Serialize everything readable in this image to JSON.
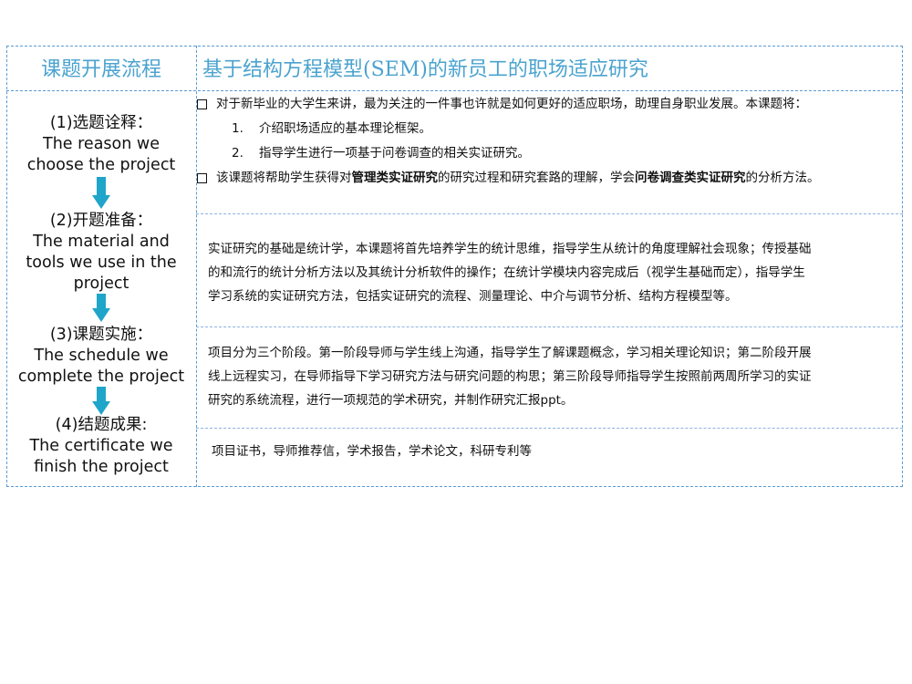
{
  "left": {
    "title": "课题开展流程",
    "steps": [
      {
        "cn": "(1)选题诠释：",
        "en1": "The reason we",
        "en2": "choose the project"
      },
      {
        "cn": "(2)开题准备：",
        "en1": "The material and",
        "en2": "tools we use in the",
        "en3": "project"
      },
      {
        "cn": "(3)课题实施：",
        "en1": "The schedule we",
        "en2": "complete the project"
      },
      {
        "cn": "(4)结题成果:",
        "en1": "The certificate we",
        "en2": "finish the project"
      }
    ]
  },
  "main": {
    "title": "基于结构方程模型(SEM)的新员工的职场适应研究",
    "section1": {
      "bullet1": "对于新毕业的大学生来讲，最为关注的一件事也许就是如何更好的适应职场，助理自身职业发展。本课题将：",
      "items": [
        {
          "num": "1.",
          "text": "介绍职场适应的基本理论框架。"
        },
        {
          "num": "2.",
          "text": "指导学生进行一项基于问卷调查的相关实证研究。"
        }
      ],
      "bullet2_a": "该课题将帮助学生获得对",
      "bullet2_b": "管理类实证研究",
      "bullet2_c": "的研究过程和研究套路的理解，学会",
      "bullet2_d": "问卷调查类实证研究",
      "bullet2_e": "的分析方法。"
    },
    "section2": {
      "line1": "实证研究的基础是统计学，本课题将首先培养学生的统计思维，指导学生从统计的角度理解社会现象；传授基础",
      "line2": "的和流行的统计分析方法以及其统计分析软件的操作；在统计学模块内容完成后（视学生基础而定），指导学生",
      "line3": "学习系统的实证研究方法，包括实证研究的流程、测量理论、中介与调节分析、结构方程模型等。"
    },
    "section3": {
      "line1": "项目分为三个阶段。第一阶段导师与学生线上沟通，指导学生了解课题概念，学习相关理论知识；第二阶段开展",
      "line2": "线上远程实习，在导师指导下学习研究方法与研究问题的构思；第三阶段导师指导学生按照前两周所学习的实证",
      "line3": "研究的系统流程，进行一项规范的学术研究，并制作研究汇报ppt。"
    },
    "section4": {
      "text": "项目证书，导师推荐信，学术报告，学术论文，科研专利等"
    }
  },
  "colors": {
    "accent": "#4ba3cf",
    "border": "#5b9bd5",
    "arrow": "#1fa5c9"
  }
}
